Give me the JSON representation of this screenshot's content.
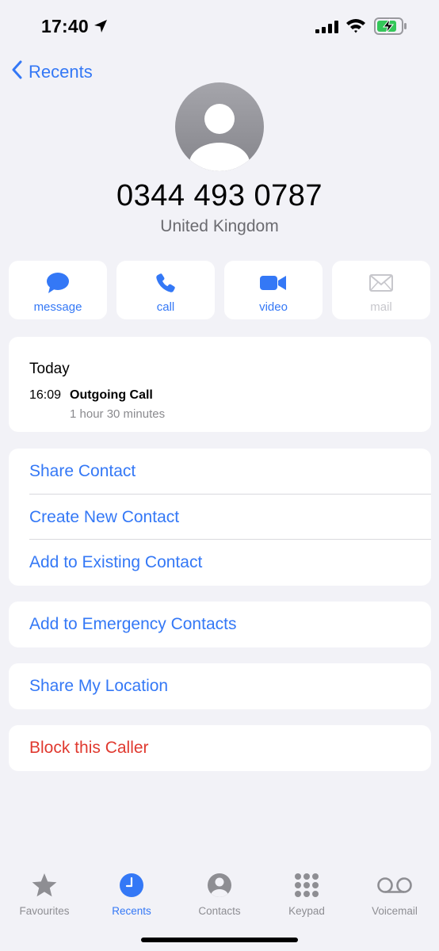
{
  "status_bar": {
    "time": "17:40"
  },
  "nav": {
    "back_label": "Recents"
  },
  "contact": {
    "number": "0344 493 0787",
    "country": "United Kingdom"
  },
  "actions": [
    {
      "label": "message",
      "icon": "message-bubble-icon",
      "enabled": true
    },
    {
      "label": "call",
      "icon": "phone-icon",
      "enabled": true
    },
    {
      "label": "video",
      "icon": "video-camera-icon",
      "enabled": true
    },
    {
      "label": "mail",
      "icon": "envelope-icon",
      "enabled": false
    }
  ],
  "call_history": {
    "day": "Today",
    "entries": [
      {
        "time": "16:09",
        "type": "Outgoing Call",
        "duration": "1 hour 30 minutes"
      }
    ]
  },
  "options": {
    "share_contact": "Share Contact",
    "create_new_contact": "Create New Contact",
    "add_to_existing": "Add to Existing Contact",
    "add_to_emergency": "Add to Emergency Contacts",
    "share_location": "Share My Location",
    "block_caller": "Block this Caller"
  },
  "tab_bar": {
    "tabs": [
      {
        "label": "Favourites",
        "icon": "star-icon",
        "active": false
      },
      {
        "label": "Recents",
        "icon": "clock-icon",
        "active": true
      },
      {
        "label": "Contacts",
        "icon": "person-circle-icon",
        "active": false
      },
      {
        "label": "Keypad",
        "icon": "keypad-grid-icon",
        "active": false
      },
      {
        "label": "Voicemail",
        "icon": "voicemail-icon",
        "active": false
      }
    ]
  },
  "colors": {
    "accent": "#3478f6",
    "destructive": "#e0392f",
    "background": "#f2f2f7",
    "battery": "#34c759"
  }
}
